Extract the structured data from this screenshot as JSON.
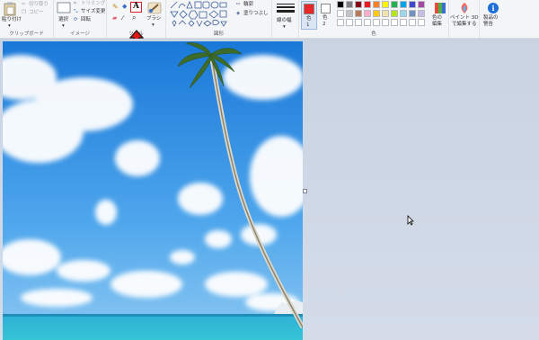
{
  "clipboard": {
    "paste": "貼り付け",
    "cut": "切り取り",
    "copy": "コピー",
    "group": "クリップボード"
  },
  "image": {
    "select": "選択",
    "crop": "トリミング",
    "resize": "サイズ変更",
    "rotate": "回転",
    "group": "イメージ"
  },
  "tools": {
    "group": "ツール",
    "brush": "ブラシ",
    "text_glyph": "A"
  },
  "shapes": {
    "outline": "輪郭",
    "fill": "塗りつぶし",
    "group": "図形"
  },
  "size": {
    "label": "線の幅"
  },
  "colors": {
    "color1": "色\n1",
    "color2": "色\n2",
    "edit": "色の\n編集",
    "group": "色",
    "color1_value": "#e8282b",
    "color2_value": "#ffffff",
    "palette_row1": [
      "#000000",
      "#7f7f7f",
      "#880015",
      "#ed1c24",
      "#ff7f27",
      "#fff200",
      "#22b14c",
      "#00a2e8",
      "#3f48cc",
      "#a349a4"
    ],
    "palette_row2": [
      "#ffffff",
      "#c3c3c3",
      "#b97a57",
      "#ffaec9",
      "#ffc90e",
      "#efe4b0",
      "#b5e61d",
      "#99d9ea",
      "#7092be",
      "#c8bfe7"
    ],
    "palette_row3": [
      "#ffffff",
      "#ffffff",
      "#ffffff",
      "#ffffff",
      "#ffffff",
      "#ffffff",
      "#ffffff",
      "#ffffff",
      "#ffffff",
      "#ffffff"
    ]
  },
  "paint3d": {
    "label": "ペイント 3D\nで編集する"
  },
  "product_alert": {
    "label": "製品の\n警告"
  }
}
